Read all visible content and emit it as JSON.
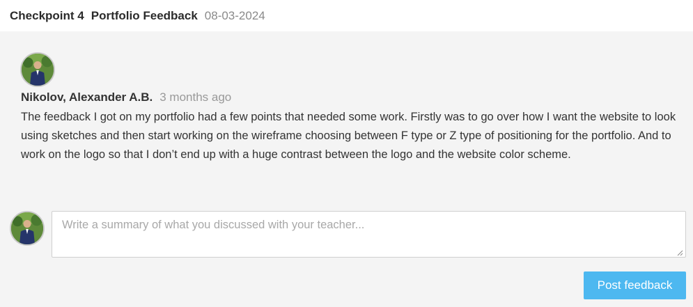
{
  "header": {
    "checkpoint": "Checkpoint 4",
    "title": "Portfolio Feedback",
    "date": "08-03-2024"
  },
  "comment": {
    "author": "Nikolov, Alexander A.B.",
    "time": "3 months ago",
    "text": "The feedback I got on my portfolio had a few points that needed some work. Firstly was to go over how I want the website to look using sketches and then start working on the wireframe choosing between F type or Z type of positioning for the portfolio. And to work on the logo so that I don’t end up with a huge contrast between the logo and the website color scheme.",
    "avatar_icon": "user-photo-avatar"
  },
  "reply": {
    "placeholder": "Write a summary of what you discussed with your teacher...",
    "value": "",
    "avatar_icon": "user-photo-avatar"
  },
  "actions": {
    "post_label": "Post feedback",
    "post_color": "#4db8f0"
  }
}
